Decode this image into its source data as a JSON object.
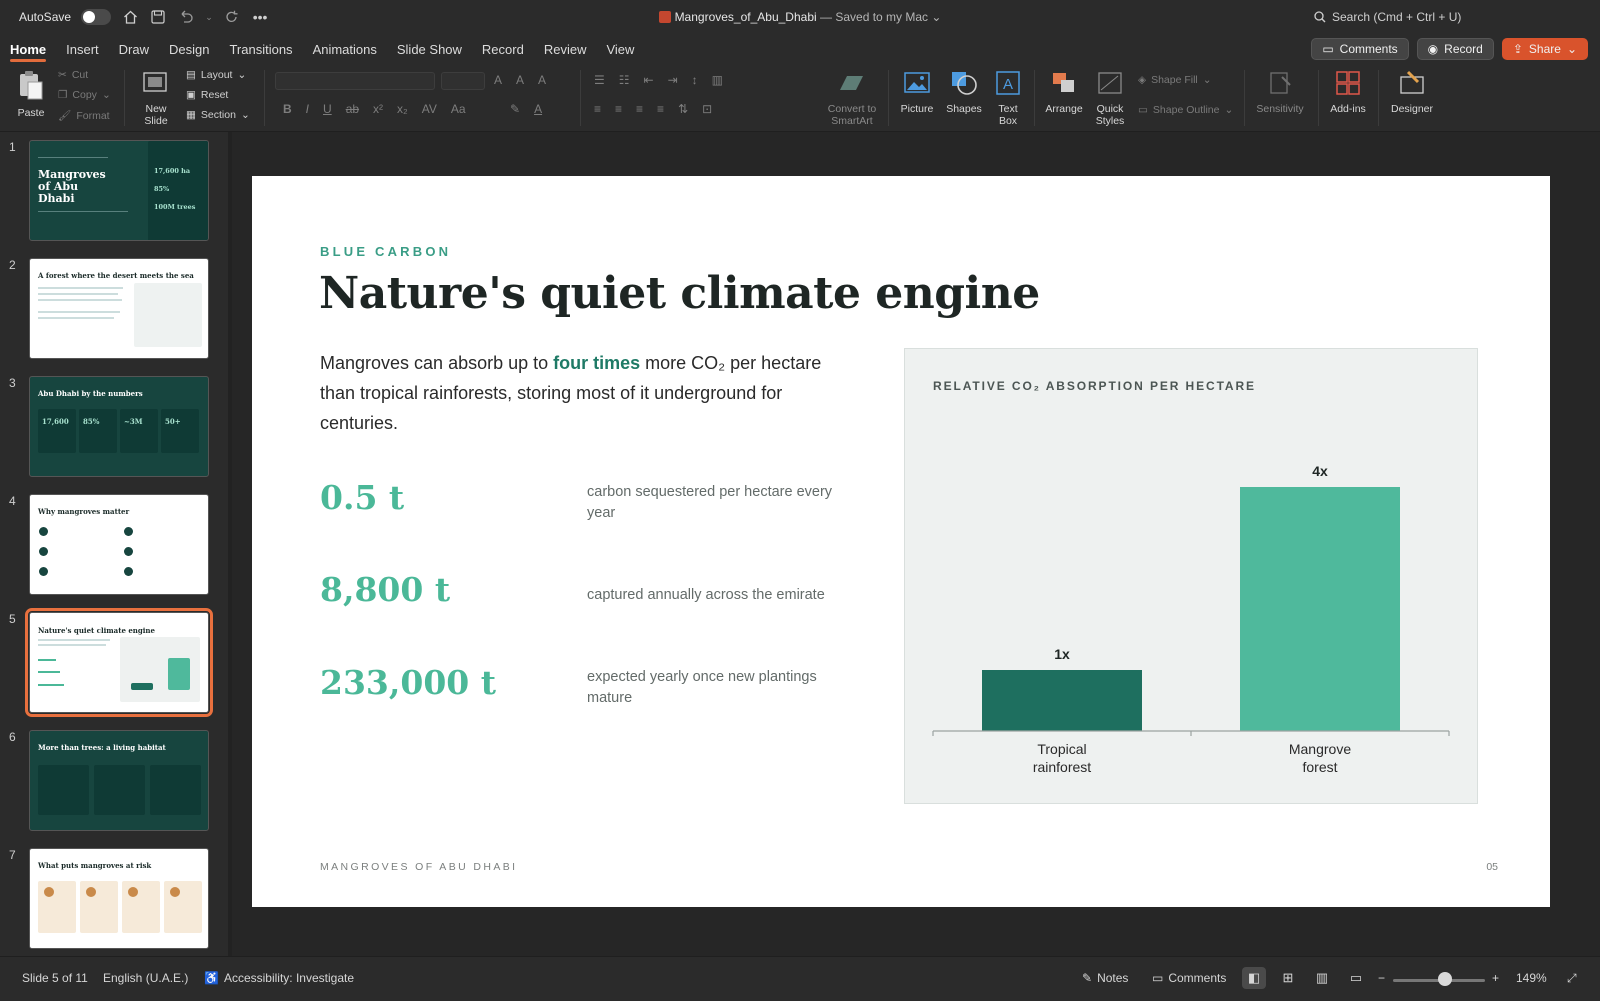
{
  "titlebar": {
    "autosave_label": "AutoSave",
    "doc_name": "Mangroves_of_Abu_Dhabi",
    "save_status": " — Saved to my Mac",
    "search_placeholder": "Search (Cmd + Ctrl + U)"
  },
  "tabs": [
    "Home",
    "Insert",
    "Draw",
    "Design",
    "Transitions",
    "Animations",
    "Slide Show",
    "Record",
    "Review",
    "View"
  ],
  "tab_actions": {
    "comments": "Comments",
    "record": "Record",
    "share": "Share"
  },
  "ribbon": {
    "paste": "Paste",
    "cut": "Cut",
    "copy": "Copy",
    "format": "Format",
    "new_slide": [
      "New",
      "Slide"
    ],
    "layout": "Layout",
    "reset": "Reset",
    "section": "Section",
    "convert_smartart": [
      "Convert to",
      "SmartArt"
    ],
    "picture": "Picture",
    "shapes": "Shapes",
    "text_box": [
      "Text",
      "Box"
    ],
    "arrange": "Arrange",
    "quick_styles": [
      "Quick",
      "Styles"
    ],
    "shape_fill": "Shape Fill",
    "shape_outline": "Shape Outline",
    "sensitivity": "Sensitivity",
    "addins": "Add-ins",
    "designer": "Designer"
  },
  "thumbnails": [
    {
      "num": "1",
      "title": "Mangroves of Abu Dhabi",
      "stats": [
        "17,600 ha",
        "85%",
        "100M trees"
      ]
    },
    {
      "num": "2",
      "title": "A forest where the desert meets the sea"
    },
    {
      "num": "3",
      "title": "Abu Dhabi by the numbers",
      "stats": [
        "17,600",
        "85%",
        "~3M",
        "50+"
      ]
    },
    {
      "num": "4",
      "title": "Why mangroves matter"
    },
    {
      "num": "5",
      "title": "Nature's quiet climate engine"
    },
    {
      "num": "6",
      "title": "More than trees: a living habitat"
    },
    {
      "num": "7",
      "title": "What puts mangroves at risk"
    }
  ],
  "slide": {
    "kicker": "BLUE CARBON",
    "title": "Nature's quiet climate engine",
    "lead_before": "Mangroves can absorb up to ",
    "lead_highlight": "four times",
    "lead_after": " more CO₂ per hectare than tropical rainforests, storing most of it underground for centuries.",
    "stats": [
      {
        "value": "0.5 t",
        "desc": "carbon sequestered per hectare every year"
      },
      {
        "value": "8,800 t",
        "desc": "captured annually across the emirate"
      },
      {
        "value": "233,000 t",
        "desc": "expected yearly once new plantings mature"
      }
    ],
    "footer_left": "MANGROVES OF ABU DHABI",
    "footer_right": "05"
  },
  "chart_data": {
    "type": "bar",
    "title": "RELATIVE CO₂ ABSORPTION PER HECTARE",
    "categories": [
      [
        "Tropical",
        "rainforest"
      ],
      [
        "Mangrove",
        "forest"
      ]
    ],
    "values": [
      1,
      4
    ],
    "data_labels": [
      "1x",
      "4x"
    ],
    "colors": [
      "#1e6f5f",
      "#4fb99c"
    ],
    "ylim": [
      0,
      4
    ],
    "grid": false,
    "legend": "none"
  },
  "status": {
    "slide_of": "Slide 5 of 11",
    "language": "English (U.A.E.)",
    "accessibility": "Accessibility: Investigate",
    "notes": "Notes",
    "comments": "Comments",
    "zoom": "149%"
  }
}
